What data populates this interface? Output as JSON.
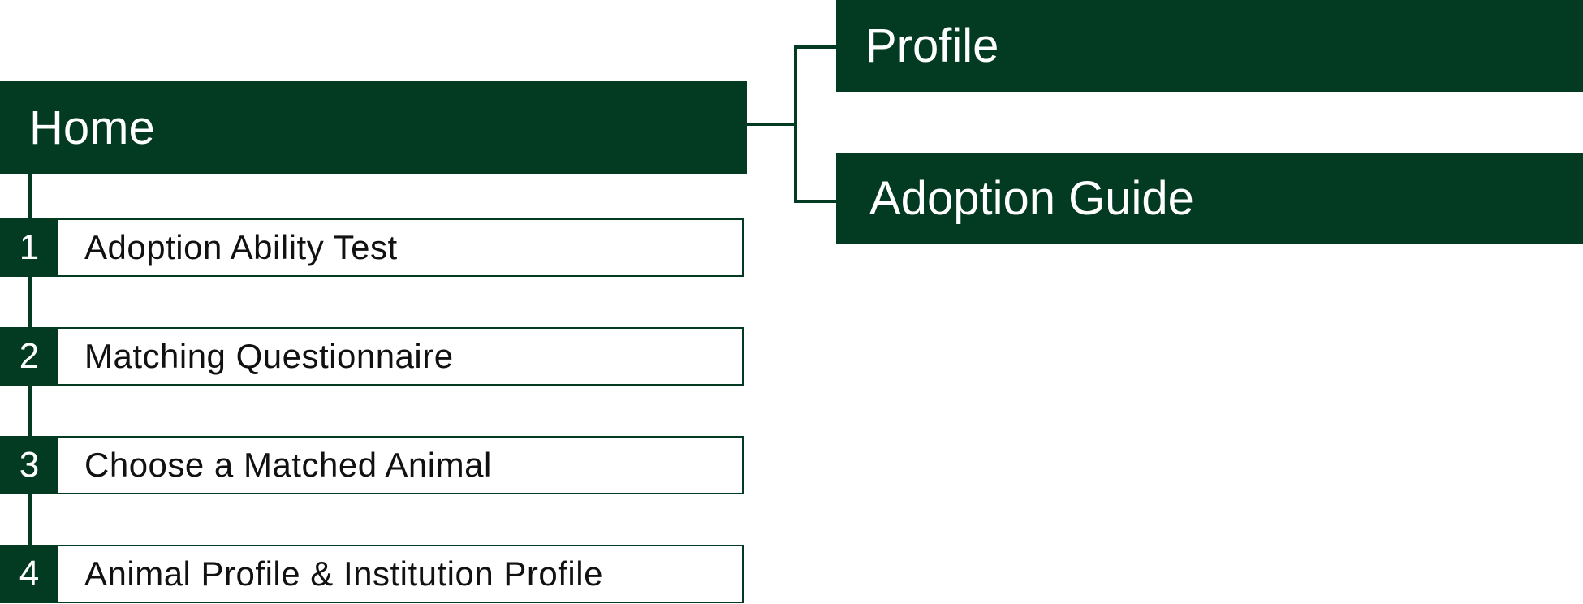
{
  "colors": {
    "primary": "#033a22"
  },
  "home": {
    "label": "Home"
  },
  "branches": [
    {
      "label": "Profile"
    },
    {
      "label": "Adoption Guide"
    }
  ],
  "steps": [
    {
      "number": "1",
      "label": "Adoption Ability Test"
    },
    {
      "number": "2",
      "label": "Matching Questionnaire"
    },
    {
      "number": "3",
      "label": "Choose a Matched Animal"
    },
    {
      "number": "4",
      "label": "Animal Profile & Institution Profile"
    }
  ]
}
